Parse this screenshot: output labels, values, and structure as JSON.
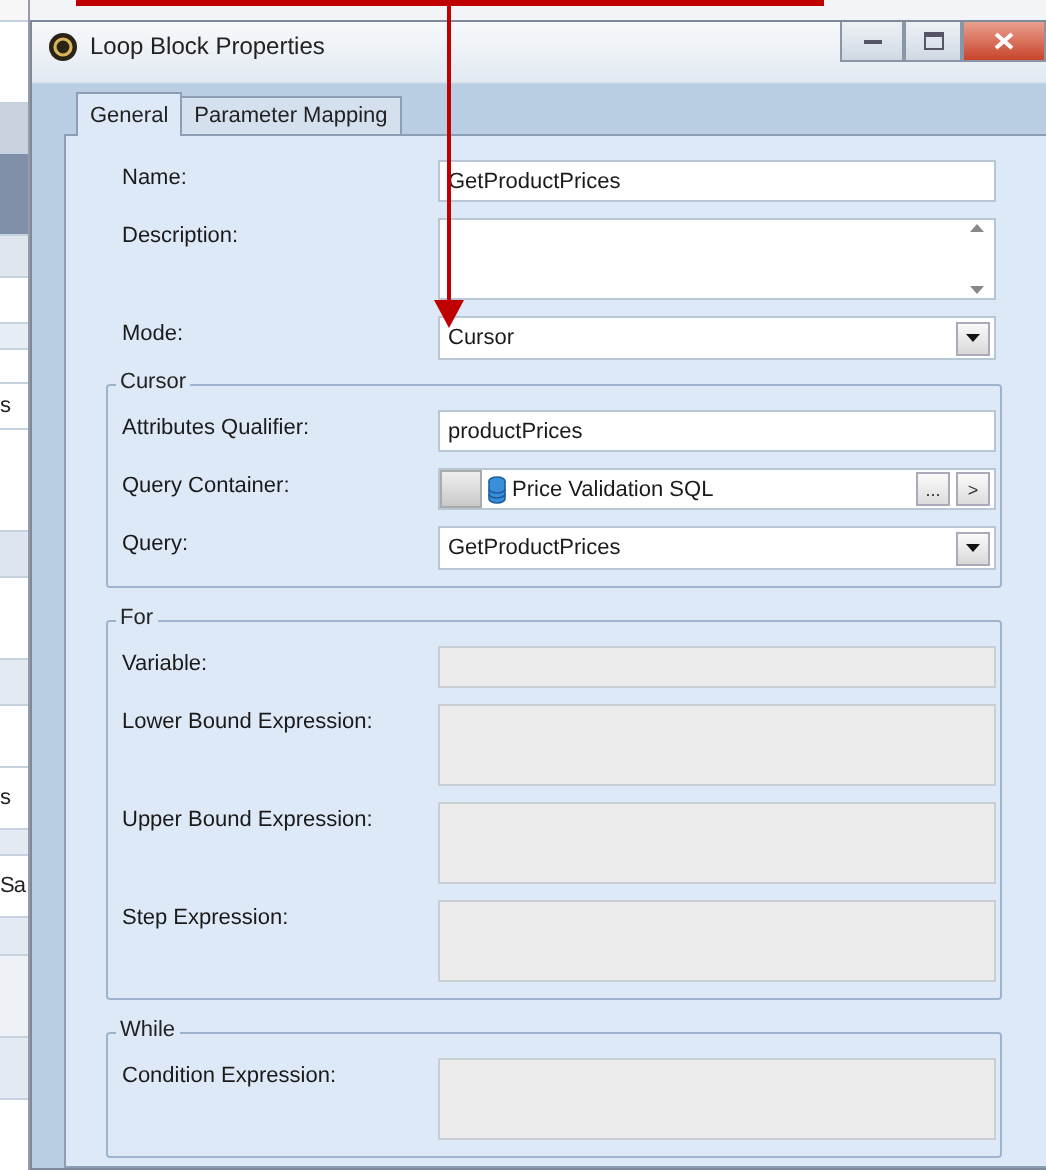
{
  "background_window": {
    "fragments": [
      "s",
      "s",
      "Sa"
    ]
  },
  "window": {
    "title": "Loop Block Properties"
  },
  "tabs": [
    {
      "label": "General",
      "selected": true
    },
    {
      "label": "Parameter Mapping",
      "selected": false
    }
  ],
  "fields": [
    {
      "kind": "text",
      "label": "Name:",
      "value": "GetProductPrices",
      "disabled": false
    },
    {
      "kind": "memo",
      "label": "Description:",
      "disabled": false
    },
    {
      "kind": "combo",
      "label": "Mode:",
      "value": "Cursor",
      "disabled": false
    }
  ],
  "groups": [
    {
      "title": "Cursor",
      "fields": [
        {
          "kind": "text",
          "label": "Attributes Qualifier:",
          "value": "productPrices",
          "disabled": false
        },
        {
          "kind": "picker",
          "label": "Query Container:",
          "value": "Price Validation SQL",
          "buttons": [
            "...",
            ">"
          ],
          "disabled": false
        },
        {
          "kind": "combo",
          "label": "Query:",
          "value": "GetProductPrices",
          "disabled": false
        }
      ]
    },
    {
      "title": "For",
      "fields": [
        {
          "kind": "text",
          "label": "Variable:",
          "disabled": true
        },
        {
          "kind": "memo",
          "label": "Lower Bound Expression:",
          "disabled": true
        },
        {
          "kind": "memo",
          "label": "Upper Bound Expression:",
          "disabled": true
        },
        {
          "kind": "memo",
          "label": "Step Expression:",
          "disabled": true
        }
      ]
    },
    {
      "title": "While",
      "fields": [
        {
          "kind": "memo",
          "label": "Condition Expression:",
          "disabled": true
        }
      ]
    }
  ]
}
